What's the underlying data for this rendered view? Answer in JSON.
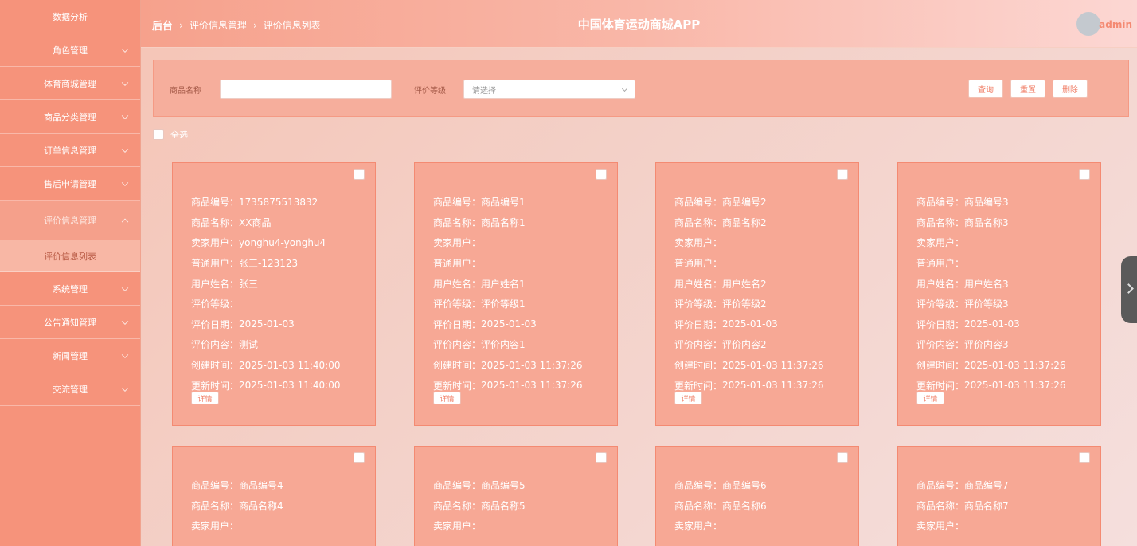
{
  "sidebar": {
    "items": [
      {
        "label": "数据分析",
        "chevron": false
      },
      {
        "label": "角色管理",
        "chevron": true
      },
      {
        "label": "体育商城管理",
        "chevron": true
      },
      {
        "label": "商品分类管理",
        "chevron": true
      },
      {
        "label": "订单信息管理",
        "chevron": true
      },
      {
        "label": "售后申请管理",
        "chevron": true
      },
      {
        "label": "评价信息管理",
        "chevron": true,
        "active": true
      },
      {
        "label": "系统管理",
        "chevron": true
      },
      {
        "label": "公告通知管理",
        "chevron": true
      },
      {
        "label": "新闻管理",
        "chevron": true
      },
      {
        "label": "交流管理",
        "chevron": true
      }
    ],
    "sub_item": "评价信息列表"
  },
  "header": {
    "breadcrumb": [
      "后台",
      "评价信息管理",
      "评价信息列表"
    ],
    "title": "中国体育运动商城APP",
    "user": "admin"
  },
  "search": {
    "name_label": "商品名称",
    "name_value": "",
    "grade_label": "评价等级",
    "grade_placeholder": "请选择",
    "query_btn": "查询",
    "reset_btn": "重置",
    "delete_btn": "删除"
  },
  "select_all": "全选",
  "labels": {
    "code": "商品编号：",
    "name": "商品名称：",
    "seller": "卖家用户：",
    "user": "普通用户：",
    "username": "用户姓名：",
    "grade": "评价等级：",
    "date": "评价日期：",
    "content": "评价内容：",
    "created": "创建时间：",
    "updated": "更新时间：",
    "detail": "详情"
  },
  "cards": [
    {
      "code": "1735875513832",
      "name": "XX商品",
      "seller": "yonghu4-yonghu4",
      "user": "张三-123123",
      "username": "张三",
      "grade": "",
      "date": "2025-01-03",
      "content": "测试",
      "created": "2025-01-03 11:40:00",
      "updated": "2025-01-03 11:40:00"
    },
    {
      "code": "商品编号1",
      "name": "商品名称1",
      "seller": "",
      "user": "",
      "username": "用户姓名1",
      "grade": "评价等级1",
      "date": "2025-01-03",
      "content": "评价内容1",
      "created": "2025-01-03 11:37:26",
      "updated": "2025-01-03 11:37:26"
    },
    {
      "code": "商品编号2",
      "name": "商品名称2",
      "seller": "",
      "user": "",
      "username": "用户姓名2",
      "grade": "评价等级2",
      "date": "2025-01-03",
      "content": "评价内容2",
      "created": "2025-01-03 11:37:26",
      "updated": "2025-01-03 11:37:26"
    },
    {
      "code": "商品编号3",
      "name": "商品名称3",
      "seller": "",
      "user": "",
      "username": "用户姓名3",
      "grade": "评价等级3",
      "date": "2025-01-03",
      "content": "评价内容3",
      "created": "2025-01-03 11:37:26",
      "updated": "2025-01-03 11:37:26"
    },
    {
      "code": "商品编号4",
      "name": "商品名称4",
      "seller": ""
    },
    {
      "code": "商品编号5",
      "name": "商品名称5",
      "seller": ""
    },
    {
      "code": "商品编号6",
      "name": "商品名称6",
      "seller": ""
    },
    {
      "code": "商品编号7",
      "name": "商品名称7",
      "seller": ""
    }
  ],
  "colors": {
    "sidebar": "#f6937b",
    "card": "#f7a895",
    "accent": "#f07e66"
  }
}
